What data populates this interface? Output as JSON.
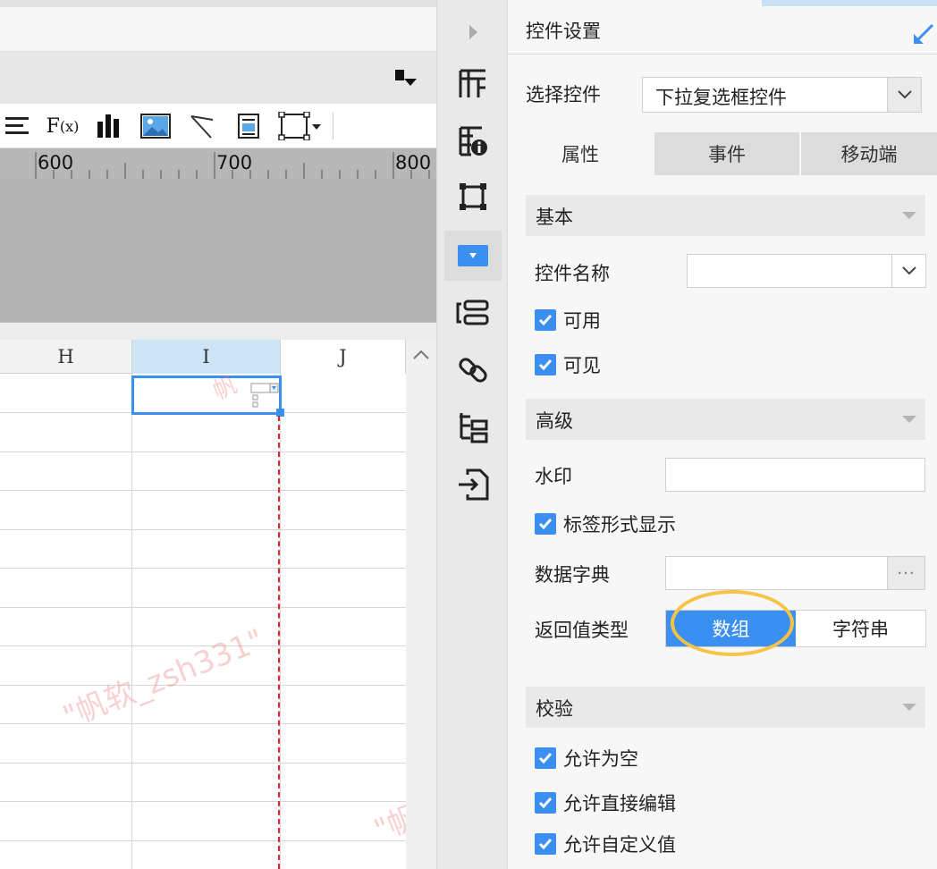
{
  "ruler": {
    "marks": [
      "600",
      "700",
      "800"
    ]
  },
  "sheet": {
    "columns": [
      "H",
      "I",
      "J"
    ],
    "watermark": [
      "\"帆软_zsh331\"",
      "\"帆"
    ]
  },
  "panel": {
    "title": "控件设置",
    "select_label": "选择控件",
    "select_value": "下拉复选框控件",
    "tabs": [
      {
        "label": "属性",
        "active": true
      },
      {
        "label": "事件",
        "active": false
      },
      {
        "label": "移动端",
        "active": false
      }
    ],
    "basic": {
      "title": "基本",
      "name_label": "控件名称",
      "name_value": "",
      "enabled_label": "可用",
      "visible_label": "可见"
    },
    "advanced": {
      "title": "高级",
      "watermark_label": "水印",
      "watermark_value": "",
      "tag_display_label": "标签形式显示",
      "dict_label": "数据字典",
      "dict_button": "···",
      "return_type_label": "返回值类型",
      "return_type_options": [
        "数组",
        "字符串"
      ],
      "return_type_selected": "数组"
    },
    "validation": {
      "title": "校验",
      "allow_empty": "允许为空",
      "allow_edit": "允许直接编辑",
      "allow_custom": "允许自定义值"
    }
  },
  "colors": {
    "accent": "#3a8ff0",
    "highlight": "#f7c344",
    "page_break": "#e8202a"
  }
}
